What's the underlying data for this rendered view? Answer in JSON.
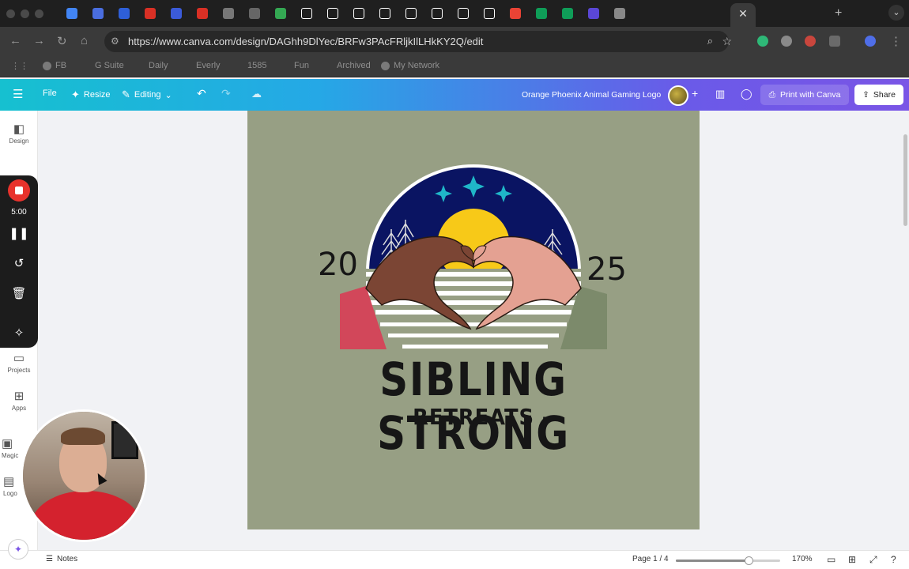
{
  "browser": {
    "url": "https://www.canva.com/design/DAGhh9DlYec/BRFw3PAcFRljkIlLHkKY2Q/edit",
    "bookmarks": [
      {
        "label": "FB"
      },
      {
        "label": "G Suite"
      },
      {
        "label": "Daily"
      },
      {
        "label": "Everly"
      },
      {
        "label": "1585"
      },
      {
        "label": "Fun"
      },
      {
        "label": "Archived"
      },
      {
        "label": "My Network"
      }
    ],
    "tab_colors": [
      "#4285f4",
      "#4a6ee0",
      "#2e5fd8",
      "#d93025",
      "#3b5bd9",
      "#d93025",
      "#777",
      "#666",
      "#34a853",
      "#fff",
      "#fff",
      "#fff",
      "#fff",
      "#fff",
      "#fff",
      "#fff",
      "#fff",
      "#ea4335",
      "#0f9d58",
      "#0f9d58",
      "#5a47d6",
      "#888"
    ],
    "tab_close_icon": "close-icon",
    "new_tab_icon": "plus-icon"
  },
  "toolbar": {
    "menu_icon": "hamburger-icon",
    "file_label": "File",
    "resize_label": "Resize",
    "editing_label": "Editing",
    "design_title": "Orange Phoenix Animal Gaming Logo",
    "print_label": "Print with Canva",
    "share_label": "Share",
    "accent_color": "#7a55e6"
  },
  "sidebar": {
    "items": [
      {
        "label": "Design",
        "icon": "design-icon"
      },
      {
        "label": "Projects",
        "icon": "folder-icon"
      },
      {
        "label": "Apps",
        "icon": "apps-icon"
      },
      {
        "label": "Magic",
        "icon": "magic-icon"
      },
      {
        "label": "Logo",
        "icon": "logo-icon"
      }
    ]
  },
  "recorder": {
    "time": "5:00",
    "stop_color": "#e8322c"
  },
  "logo": {
    "line1": "SIBLING STRONG",
    "line2": "— RETREATS —",
    "year_left": "20",
    "year_right": "25",
    "background_color": "#979f84",
    "sky_color": "#0a1462",
    "sun_color": "#f7c918",
    "star_color": "#1fb6c8"
  },
  "status": {
    "notes_label": "Notes",
    "page_label": "Page 1 / 4",
    "zoom_label": "170%",
    "zoom_fraction": 0.7
  }
}
